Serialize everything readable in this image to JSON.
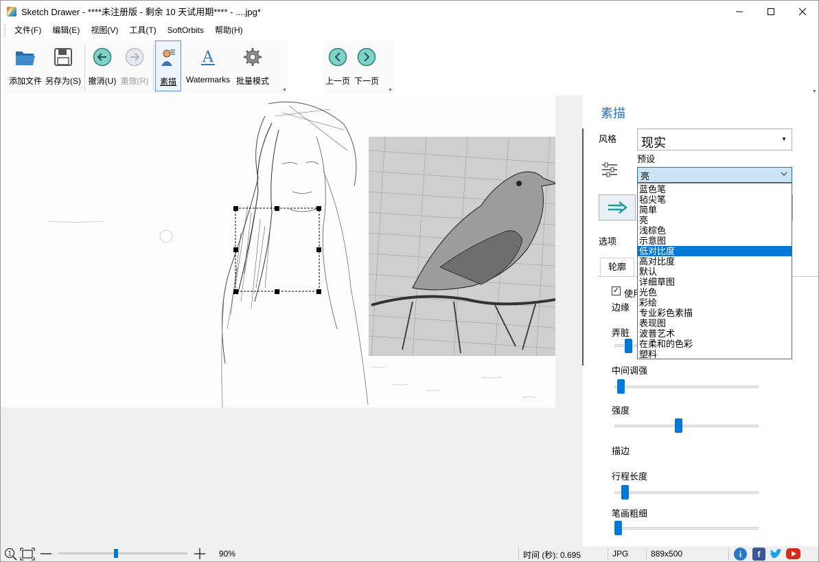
{
  "window": {
    "title": "Sketch Drawer - ****未注册版 - 剩余 10 天试用期**** - ....jpg*"
  },
  "menu": [
    "文件(F)",
    "编辑(E)",
    "视图(V)",
    "工具(T)",
    "SoftOrbits",
    "帮助(H)"
  ],
  "toolbar": {
    "add_file": "添加文件",
    "save_as": "另存为(S)",
    "undo": "撤消(U)",
    "redo": "重做(R)",
    "sketch": "素描",
    "watermarks": "Watermarks",
    "batch": "批量模式",
    "prev_page": "上一页",
    "next_page": "下一页"
  },
  "panel": {
    "title": "素描",
    "style_label": "风格",
    "style_value": "现实",
    "preset_label": "预设",
    "preset_value": "亮",
    "options_label": "选项",
    "tab_outline": "轮廓",
    "use_label": "使用",
    "edge_label": "边缘",
    "dirty_label": "弄脏",
    "midtone_label": "中间调强",
    "intensity_label": "强度",
    "stroke_section": "描边",
    "stroke_length_label": "行程长度",
    "stroke_width_label": "笔画粗细",
    "preset_options": [
      "蓝色笔",
      "毡尖笔",
      "简单",
      "亮",
      "浅棕色",
      "示意图",
      "低对比度",
      "高对比度",
      "默认",
      "详细草图",
      "光色",
      "彩绘",
      "专业彩色素描",
      "表现图",
      "波普艺术",
      "在柔和的色彩",
      "塑料"
    ],
    "preset_highlighted": "低对比度",
    "slider_levels": {
      "midtone": 0.04,
      "intensity": 0.44,
      "stroke_length": 0.07,
      "stroke_width": 0.02
    }
  },
  "status": {
    "zoom": "90%",
    "zoom_level": 0.44,
    "time": "时间 (秒): 0.695",
    "format": "JPG",
    "dimensions": "889x500"
  },
  "colors": {
    "accent": "#0078d7",
    "panel_title": "#1f76c6",
    "selection": "#0078d7"
  }
}
